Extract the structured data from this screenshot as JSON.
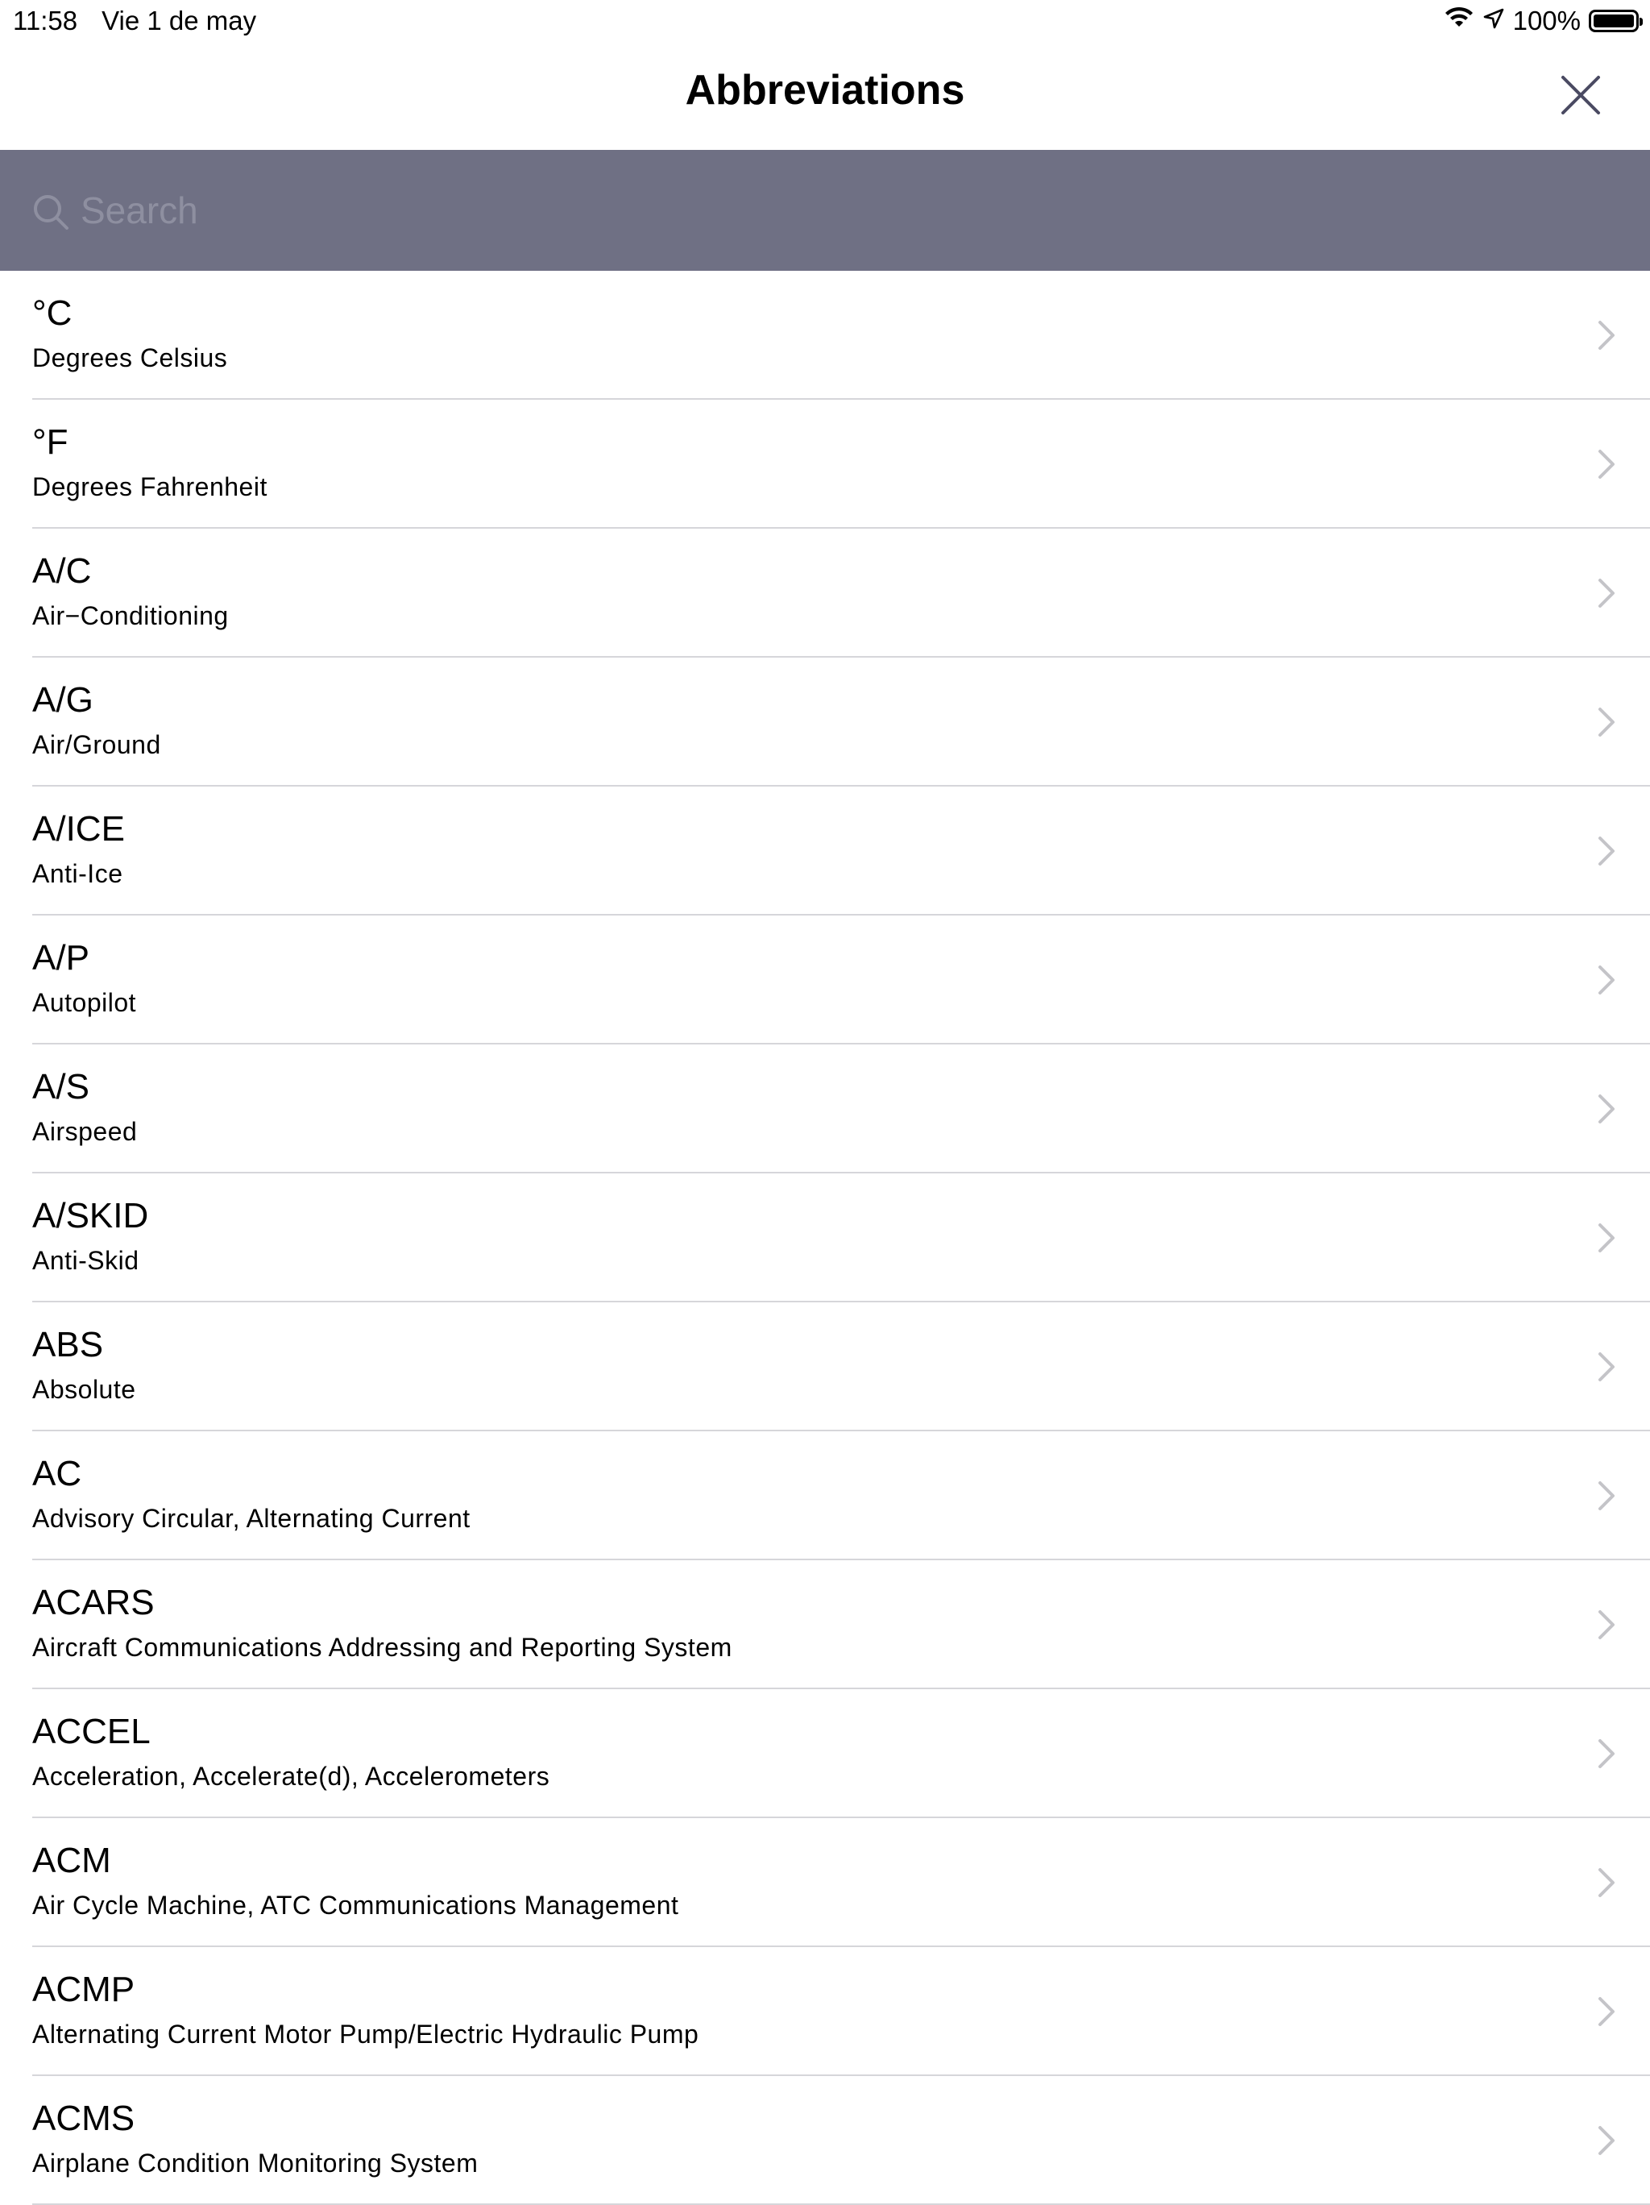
{
  "status_bar": {
    "time": "11:58",
    "date": "Vie 1 de may",
    "battery": "100%"
  },
  "nav": {
    "title": "Abbreviations"
  },
  "search": {
    "placeholder": "Search",
    "value": ""
  },
  "items": [
    {
      "abbr": "°C",
      "meaning": "Degrees Celsius"
    },
    {
      "abbr": "°F",
      "meaning": "Degrees Fahrenheit"
    },
    {
      "abbr": "A/C",
      "meaning": "Air−Conditioning"
    },
    {
      "abbr": "A/G",
      "meaning": "Air/Ground"
    },
    {
      "abbr": "A/ICE",
      "meaning": "Anti-Ice"
    },
    {
      "abbr": "A/P",
      "meaning": "Autopilot"
    },
    {
      "abbr": "A/S",
      "meaning": "Airspeed"
    },
    {
      "abbr": "A/SKID",
      "meaning": "Anti-Skid"
    },
    {
      "abbr": "ABS",
      "meaning": "Absolute"
    },
    {
      "abbr": "AC",
      "meaning": "Advisory Circular, Alternating Current"
    },
    {
      "abbr": "ACARS",
      "meaning": "Aircraft Communications Addressing and Reporting System"
    },
    {
      "abbr": "ACCEL",
      "meaning": "Acceleration, Accelerate(d), Accelerometers"
    },
    {
      "abbr": "ACM",
      "meaning": "Air Cycle Machine, ATC Communications Management"
    },
    {
      "abbr": "ACMP",
      "meaning": "Alternating Current Motor Pump/Electric Hydraulic Pump"
    },
    {
      "abbr": "ACMS",
      "meaning": "Airplane Condition Monitoring System"
    }
  ],
  "colors": {
    "search_bar_bg": "#6f7084",
    "separator": "#d6d6da",
    "chevron": "#c4c4c8",
    "close_icon": "#4a4a62"
  }
}
